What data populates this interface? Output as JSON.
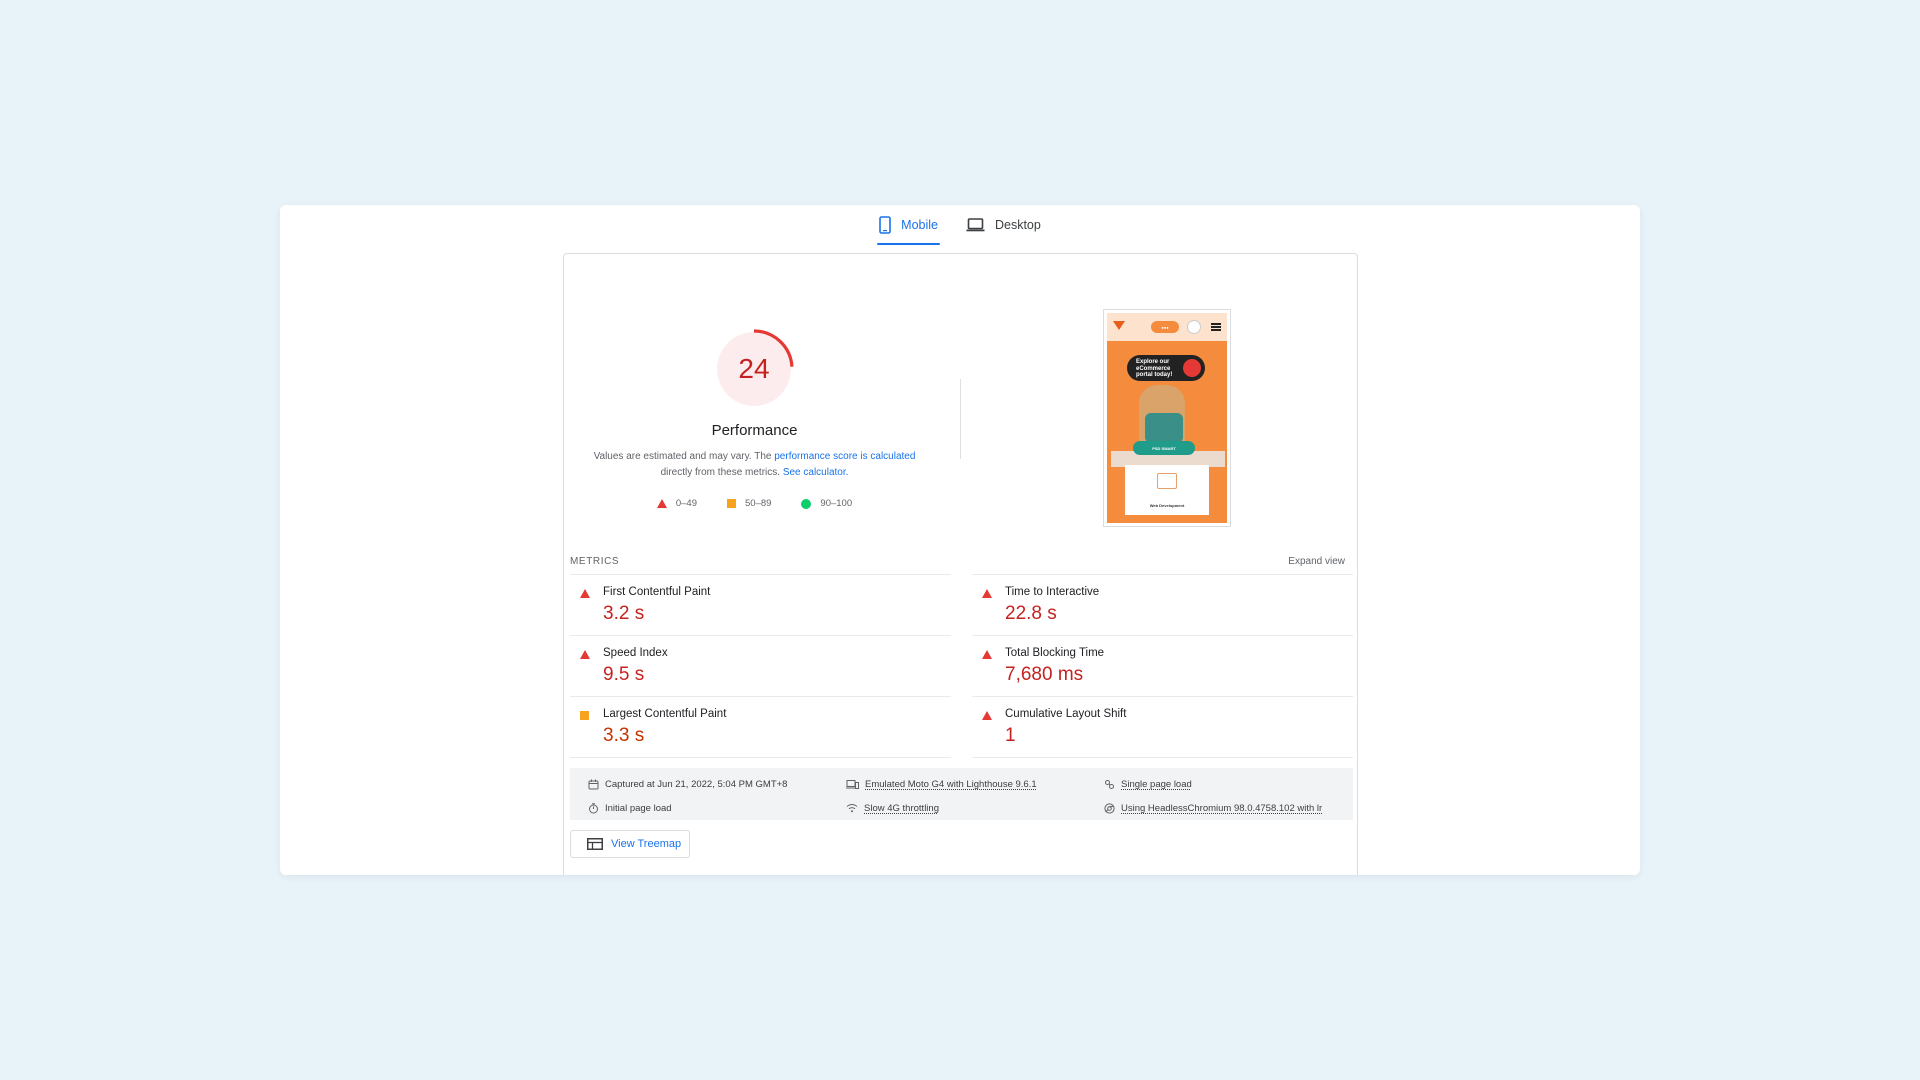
{
  "tabs": [
    {
      "label": "Mobile",
      "icon": "phone-icon",
      "active": true
    },
    {
      "label": "Desktop",
      "icon": "laptop-icon",
      "active": false
    }
  ],
  "score": {
    "value": "24",
    "fraction": 0.24,
    "title": "Performance",
    "desc_prefix": "Values are estimated and may vary. The ",
    "desc_link1": "performance score is calculated",
    "desc_middle": " directly from these metrics. ",
    "desc_link2": "See calculator.",
    "legend": [
      "0–49",
      "50–89",
      "90–100"
    ]
  },
  "screenshot": {
    "bubble_line1": "Explore our",
    "bubble_line2": "eCommerce",
    "bubble_line3": "portal today!",
    "band_text": "PSD SMART",
    "card_label": "Web Development"
  },
  "metrics": {
    "header": "METRICS",
    "expand": "Expand view",
    "items": [
      {
        "name": "First Contentful Paint",
        "value": "3.2 s",
        "rating": "bad"
      },
      {
        "name": "Time to Interactive",
        "value": "22.8 s",
        "rating": "bad"
      },
      {
        "name": "Speed Index",
        "value": "9.5 s",
        "rating": "bad"
      },
      {
        "name": "Total Blocking Time",
        "value": "7,680 ms",
        "rating": "bad"
      },
      {
        "name": "Largest Contentful Paint",
        "value": "3.3 s",
        "rating": "average"
      },
      {
        "name": "Cumulative Layout Shift",
        "value": "1",
        "rating": "bad"
      }
    ]
  },
  "runtime": {
    "captured": "Captured at Jun 21, 2022, 5:04 PM GMT+8",
    "device": "Emulated Moto G4 with Lighthouse 9.6.1",
    "load_type": "Single page load",
    "initial": "Initial page load",
    "throttling": "Slow 4G throttling",
    "browser": "Using HeadlessChromium 98.0.4758.102 with lr"
  },
  "treemap": {
    "label": "View Treemap"
  },
  "colors": {
    "bad": "#c5221f",
    "average": "#c33300",
    "good": "#0cce6b",
    "accent": "#1a73e8"
  }
}
